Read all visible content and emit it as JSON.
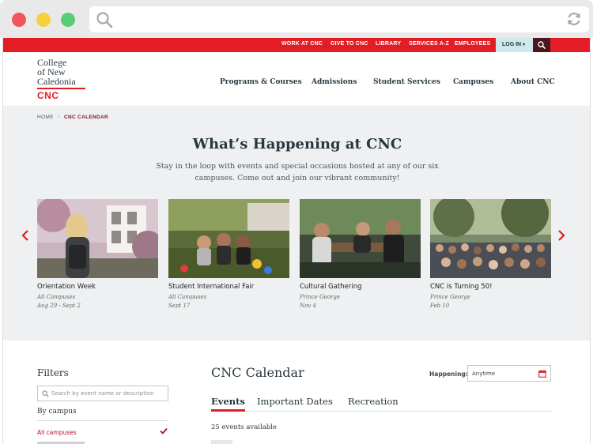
{
  "colors": {
    "brand_red": "#e31d25",
    "dark_maroon": "#4a1620",
    "login_bg": "#cfe8ec",
    "text_dark": "#28373e",
    "hero_bg": "#eef0f1"
  },
  "browser": {
    "search_icon": "search-icon",
    "reload_icon": "reload-icon"
  },
  "utility_nav": {
    "links": [
      "WORK AT CNC",
      "GIVE TO CNC",
      "LIBRARY",
      "SERVICES A-Z",
      "EMPLOYEES"
    ],
    "login_label": "LOG IN",
    "search_icon": "search-icon"
  },
  "logo": {
    "line1": "College",
    "line2": "of New",
    "line3": "Caledonia",
    "short": "CNC"
  },
  "main_nav": [
    "Programs & Courses",
    "Admissions",
    "Student Services",
    "Campuses",
    "About CNC"
  ],
  "breadcrumb": {
    "home": "HOME",
    "current": "CNC CALENDAR"
  },
  "hero": {
    "title": "What’s Happening at CNC",
    "subtitle": "Stay in the loop with events and special occasions hosted at any of our six campuses. Come out and join our vibrant community!"
  },
  "cards": [
    {
      "title": "Orientation Week",
      "campus": "All Campuses",
      "date": "Aug 29 - Sept 2"
    },
    {
      "title": "Student International Fair",
      "campus": "All Campuses",
      "date": "Sept 17"
    },
    {
      "title": "Cultural Gathering",
      "campus": "Prince George",
      "date": "Nov 4"
    },
    {
      "title": "CNC is Turning 50!",
      "campus": "Prince George",
      "date": "Feb 10"
    }
  ],
  "filters": {
    "title": "Filters",
    "search_placeholder": "Search by event name or description",
    "by_campus": "By campus",
    "selected": "All campuses"
  },
  "calendar": {
    "title": "CNC Calendar",
    "happening_label": "Happening:",
    "happening_value": "Anytime",
    "tabs": [
      "Events",
      "Important Dates",
      "Recreation"
    ],
    "count_text": "25 events available"
  }
}
